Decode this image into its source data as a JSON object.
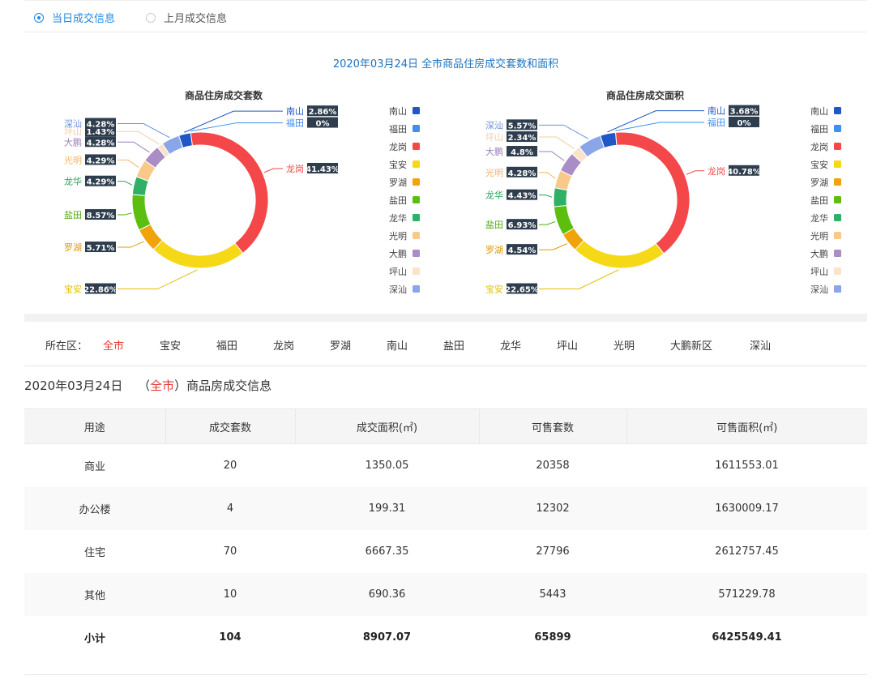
{
  "options": [
    {
      "label": "当日成交信息",
      "checked": true
    },
    {
      "label": "上月成交信息",
      "checked": false
    }
  ],
  "main_title": "2020年03月24日 全市商品住房成交套数和面积",
  "chart_data": [
    {
      "type": "pie",
      "title": "商品住房成交套数",
      "categories": [
        "南山",
        "福田",
        "龙岗",
        "宝安",
        "罗湖",
        "盐田",
        "龙华",
        "光明",
        "大鹏",
        "坪山",
        "深汕"
      ],
      "values": [
        2.86,
        0,
        41.43,
        22.86,
        5.71,
        8.57,
        4.29,
        4.29,
        4.28,
        1.43,
        4.28
      ],
      "labels": [
        "2.86%",
        "0%",
        "41.43%",
        "22.86%",
        "5.71%",
        "8.57%",
        "4.29%",
        "4.29%",
        "4.28%",
        "1.43%",
        "4.28%"
      ],
      "colors": [
        "#1f57c6",
        "#3f8ef2",
        "#f4474a",
        "#f5d816",
        "#f0a30a",
        "#5cbf10",
        "#2eb067",
        "#f9c98a",
        "#aa8cc6",
        "#fae3c8",
        "#8aa6e8"
      ],
      "legend": "right",
      "donut": true
    },
    {
      "type": "pie",
      "title": "商品住房成交面积",
      "categories": [
        "南山",
        "福田",
        "龙岗",
        "宝安",
        "罗湖",
        "盐田",
        "龙华",
        "光明",
        "大鹏",
        "坪山",
        "深汕"
      ],
      "values": [
        3.68,
        0,
        40.78,
        22.65,
        4.54,
        6.93,
        4.43,
        4.28,
        4.8,
        2.34,
        5.57
      ],
      "labels": [
        "3.68%",
        "0%",
        "40.78%",
        "22.65%",
        "4.54%",
        "6.93%",
        "4.43%",
        "4.28%",
        "4.8%",
        "2.34%",
        "5.57%"
      ],
      "colors": [
        "#1f57c6",
        "#3f8ef2",
        "#f4474a",
        "#f5d816",
        "#f0a30a",
        "#5cbf10",
        "#2eb067",
        "#f9c98a",
        "#aa8cc6",
        "#fae3c8",
        "#8aa6e8"
      ],
      "legend": "right",
      "donut": true
    }
  ],
  "filter": {
    "prefix": "所在区：",
    "items": [
      "全市",
      "宝安",
      "福田",
      "龙岗",
      "罗湖",
      "南山",
      "盐田",
      "龙华",
      "坪山",
      "光明",
      "大鹏新区",
      "深汕"
    ],
    "active": "全市"
  },
  "subhead": {
    "date": "2020年03月24日",
    "open": "（",
    "area": "全市",
    "close": "）商品房成交信息"
  },
  "table": {
    "headers": [
      "用途",
      "成交套数",
      "成交面积(㎡)",
      "可售套数",
      "可售面积(㎡)"
    ],
    "rows": [
      [
        "商业",
        "20",
        "1350.05",
        "20358",
        "1611553.01"
      ],
      [
        "办公楼",
        "4",
        "199.31",
        "12302",
        "1630009.17"
      ],
      [
        "住宅",
        "70",
        "6667.35",
        "27796",
        "2612757.45"
      ],
      [
        "其他",
        "10",
        "690.36",
        "5443",
        "571229.78"
      ]
    ],
    "total": [
      "小计",
      "104",
      "8907.07",
      "65899",
      "6425549.41"
    ]
  }
}
